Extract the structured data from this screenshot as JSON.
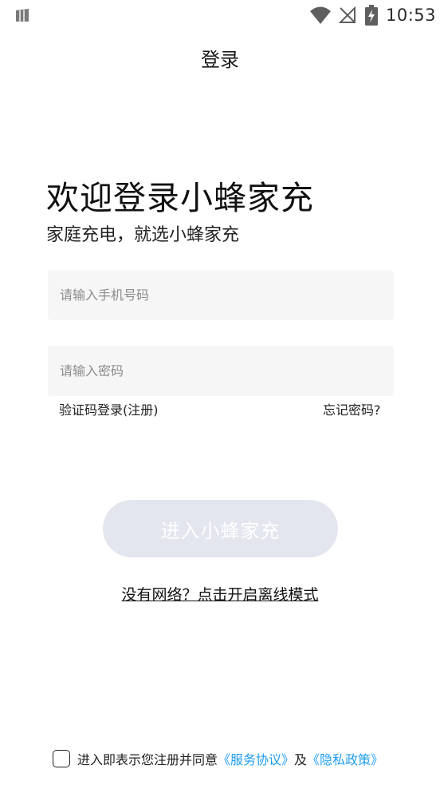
{
  "status_bar": {
    "time": "10:53",
    "icons": [
      "sim-card-icon",
      "wifi-icon",
      "no-signal-icon",
      "battery-charging-icon"
    ]
  },
  "nav": {
    "title": "登录"
  },
  "welcome": {
    "title": "欢迎登录小蜂家充",
    "subtitle": "家庭充电，就选小蜂家充"
  },
  "form": {
    "phone_placeholder": "请输入手机号码",
    "phone_value": "",
    "password_placeholder": "请输入密码",
    "password_value": "",
    "sms_login_link": "验证码登录(注册)",
    "forgot_password_link": "忘记密码?"
  },
  "enter_button": {
    "label": "进入小蜂家充"
  },
  "offline_link": "没有网络？点击开启离线模式",
  "agreement": {
    "checked": false,
    "prefix": "进入即表示您注册并同意",
    "service_link": "《服务协议》",
    "and": "及",
    "privacy_link": "《隐私政策》"
  },
  "colors": {
    "background": "#ffffff",
    "input_background": "#f6f6f6",
    "button_disabled": "#e3e6ee",
    "link_blue": "#1f9df0"
  }
}
